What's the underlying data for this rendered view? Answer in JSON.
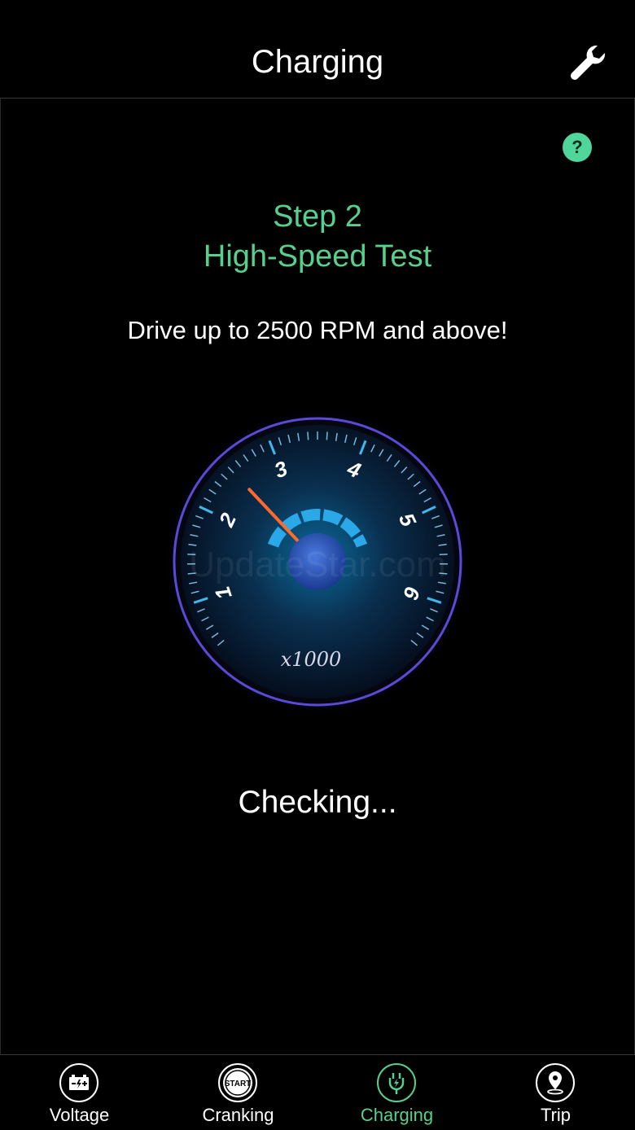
{
  "header": {
    "title": "Charging"
  },
  "help": {
    "label": "?"
  },
  "step": {
    "title": "Step 2",
    "subtitle": "High-Speed Test"
  },
  "instruction": "Drive up to 2500 RPM and above!",
  "gauge": {
    "tick_labels": [
      "1",
      "2",
      "3",
      "4",
      "5",
      "6"
    ],
    "unit": "x1000",
    "needle_value": 2.5,
    "min": 0.5,
    "max": 6.5,
    "watermark": "UpdateStar.com"
  },
  "status": "Checking...",
  "tabs": [
    {
      "label": "Voltage",
      "icon": "battery-icon",
      "active": false
    },
    {
      "label": "Cranking",
      "icon": "start-icon",
      "start_text": "START",
      "active": false
    },
    {
      "label": "Charging",
      "icon": "plug-icon",
      "active": true
    },
    {
      "label": "Trip",
      "icon": "location-pin-icon",
      "active": false
    }
  ],
  "colors": {
    "accent": "#57d08e",
    "help_bg": "#4fd69a",
    "needle": "#ff6a2a",
    "gauge_blue": "#2aa8e8"
  }
}
